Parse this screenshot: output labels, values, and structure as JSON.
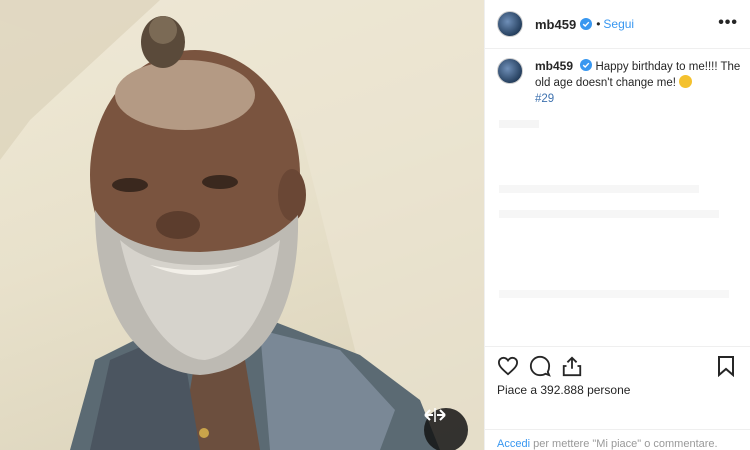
{
  "post": {
    "username": "mb459",
    "follow_label": "Segui",
    "more_label": "•••",
    "caption_text": "Happy birthday to me!!!! The old age doesn't change me!",
    "hashtag": "#29",
    "likes_text": "Piace a 392.888 persone",
    "login_link": "Accedi",
    "login_rest": "per mettere \"Mi piace\" o commentare."
  },
  "icons": {
    "like": "heart-icon",
    "comment": "comment-icon",
    "share": "share-icon",
    "save": "bookmark-icon",
    "expand": "expand-arrows-icon",
    "verified": "verified-badge-icon"
  },
  "colors": {
    "link": "#3897f0",
    "verified": "#3897f0",
    "hashtag": "#3f72af"
  }
}
